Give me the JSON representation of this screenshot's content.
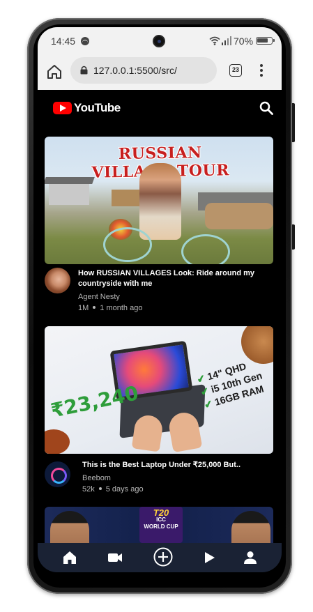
{
  "status_bar": {
    "time": "14:45",
    "battery": "70%"
  },
  "browser": {
    "url": "127.0.0.1:5500/src/",
    "tab_count": "23"
  },
  "app": {
    "name": "YouTube",
    "brand_color": "#ff0000"
  },
  "videos": [
    {
      "thumbnail_text": "RUSSIAN VILLAGE TOUR",
      "title": "How RUSSIAN VILLAGES Look: Ride around my countryside with me",
      "channel": "Agent Nesty",
      "views": "1M",
      "age": "1 month ago"
    },
    {
      "thumbnail_price": "₹23,240",
      "thumbnail_specs": [
        "14\" QHD",
        "i5 10th Gen",
        "16GB RAM"
      ],
      "title": "This is the Best Laptop Under ₹25,000 But..",
      "channel": "Beebom",
      "views": "52k",
      "age": "5 days ago"
    },
    {
      "thumbnail_badge": [
        "T20",
        "ICC",
        "WORLD CUP"
      ]
    }
  ],
  "bottom_nav": {
    "icons": [
      "home-icon",
      "video-camera-icon",
      "add-circle-icon",
      "play-icon",
      "person-icon"
    ],
    "background": "#1a2234"
  }
}
